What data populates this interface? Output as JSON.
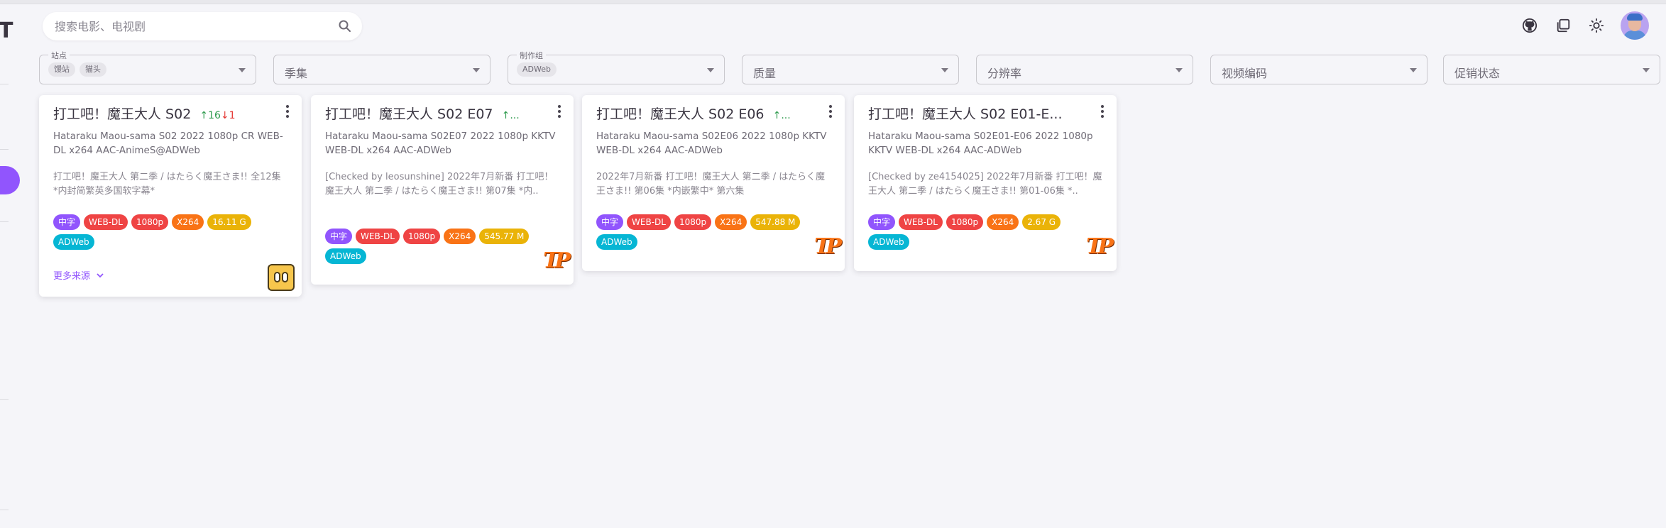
{
  "left_rail": {
    "logo_letter": "T"
  },
  "search": {
    "placeholder": "搜索电影、电视剧"
  },
  "top_icons": [
    "github-icon",
    "copy-icon",
    "sun-icon",
    "avatar"
  ],
  "filters": [
    {
      "legend": "站点",
      "chips": [
        "馒站",
        "猫头"
      ]
    },
    {
      "placeholder": "季集"
    },
    {
      "legend": "制作组",
      "chips": [
        "ADWeb"
      ]
    },
    {
      "placeholder": "质量"
    },
    {
      "placeholder": "分辨率"
    },
    {
      "placeholder": "视频编码"
    },
    {
      "placeholder": "促销状态"
    }
  ],
  "cards": [
    {
      "title": "打工吧！魔王大人 S02",
      "seeders": "↑16",
      "leechers": "↓1",
      "subtitle": "Hataraku Maou-sama S02 2022 1080p CR WEB-DL x264 AAC-AnimeS@ADWeb",
      "description": "打工吧！魔王大人 第二季 / はたらく魔王さま!! 全12集 *内封简繁英多国软字幕*",
      "tags": [
        {
          "text": "中字",
          "color": "#9155fd"
        },
        {
          "text": "WEB-DL",
          "color": "#ef4444"
        },
        {
          "text": "1080p",
          "color": "#ef4444"
        },
        {
          "text": "X264",
          "color": "#f97316"
        },
        {
          "text": "16.11 G",
          "color": "#eab308"
        },
        {
          "text": "ADWeb",
          "color": "#06b6d4"
        }
      ],
      "more_sources": "更多来源",
      "site_icon": "robot-logo-icon"
    },
    {
      "title": "打工吧！魔王大人 S02 E07",
      "seeders": "↑...",
      "subtitle": "Hataraku Maou-sama S02E07 2022 1080p KKTV WEB-DL x264 AAC-ADWeb",
      "description": "[Checked by leosunshine] 2022年7月新番 打工吧！魔王大人 第二季 / はたらく魔王さま!! 第07集 *内..",
      "tags": [
        {
          "text": "中字",
          "color": "#9155fd"
        },
        {
          "text": "WEB-DL",
          "color": "#ef4444"
        },
        {
          "text": "1080p",
          "color": "#ef4444"
        },
        {
          "text": "X264",
          "color": "#f97316"
        },
        {
          "text": "545.77 M",
          "color": "#eab308"
        },
        {
          "text": "ADWeb",
          "color": "#06b6d4"
        }
      ],
      "site_icon": "pt-logo-icon"
    },
    {
      "title": "打工吧！魔王大人 S02 E06",
      "seeders": "↑...",
      "subtitle": "Hataraku Maou-sama S02E06 2022 1080p KKTV WEB-DL x264 AAC-ADWeb",
      "description": "2022年7月新番 打工吧！魔王大人 第二季 / はたらく魔王さま!! 第06集 *内嵌繁中* 第六集",
      "tags": [
        {
          "text": "中字",
          "color": "#9155fd"
        },
        {
          "text": "WEB-DL",
          "color": "#ef4444"
        },
        {
          "text": "1080p",
          "color": "#ef4444"
        },
        {
          "text": "X264",
          "color": "#f97316"
        },
        {
          "text": "547.88 M",
          "color": "#eab308"
        },
        {
          "text": "ADWeb",
          "color": "#06b6d4"
        }
      ],
      "site_icon": "pt-logo-icon"
    },
    {
      "title": "打工吧！魔王大人 S02 E01-E...",
      "subtitle": "Hataraku Maou-sama S02E01-E06 2022 1080p KKTV WEB-DL x264 AAC-ADWeb",
      "description": "[Checked by ze4154025] 2022年7月新番 打工吧！魔王大人 第二季 / はたらく魔王さま!! 第01-06集 *..",
      "tags": [
        {
          "text": "中字",
          "color": "#9155fd"
        },
        {
          "text": "WEB-DL",
          "color": "#ef4444"
        },
        {
          "text": "1080p",
          "color": "#ef4444"
        },
        {
          "text": "X264",
          "color": "#f97316"
        },
        {
          "text": "2.67 G",
          "color": "#eab308"
        },
        {
          "text": "ADWeb",
          "color": "#06b6d4"
        }
      ],
      "site_icon": "pt-logo-icon"
    }
  ],
  "colors": {
    "primary": "#9155fd",
    "background": "#f5f5f9",
    "seed_up": "#2e9b4e",
    "seed_down": "#e53935"
  },
  "pt_logo_text": "TP"
}
